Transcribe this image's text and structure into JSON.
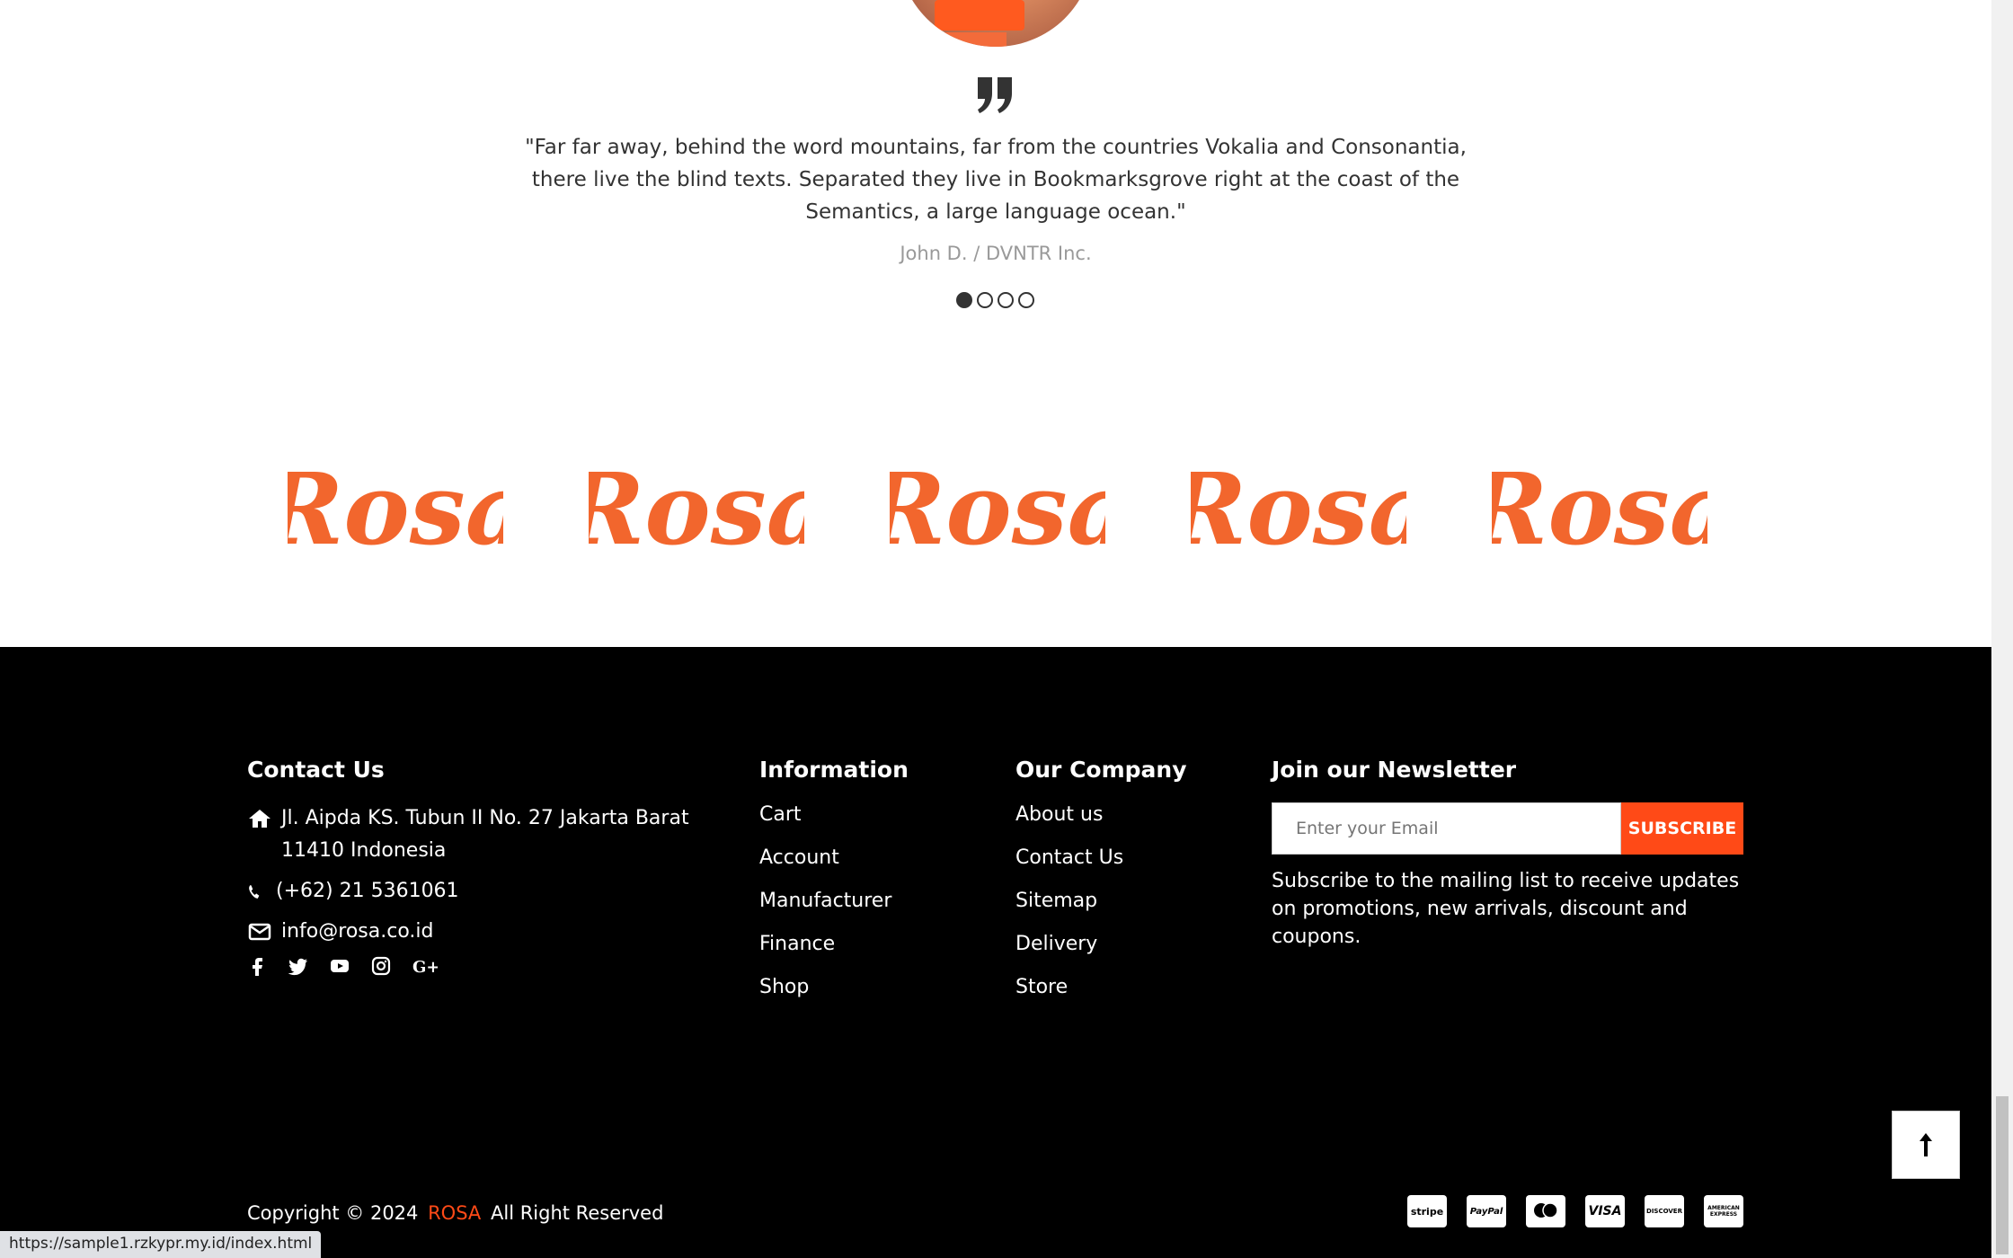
{
  "testimonial": {
    "quote": "\"Far far away, behind the word mountains, far from the countries Vokalia and Consonantia, there live the blind texts. Separated they live in Bookmarksgrove right at the coast of the Semantics, a large language ocean.\"",
    "author": "John D. / DVNTR Inc.",
    "active_dot": 1,
    "dot_count": 4
  },
  "logos": [
    "Rosa",
    "Rosa",
    "Rosa",
    "Rosa",
    "Rosa"
  ],
  "footer": {
    "contact": {
      "title": "Contact Us",
      "address": "Jl. Aipda KS. Tubun II No. 27 Jakarta Barat 11410 Indonesia",
      "phone": "(+62) 21 5361061",
      "email": "info@rosa.co.id",
      "social_icons": [
        "facebook-icon",
        "twitter-icon",
        "youtube-icon",
        "instagram-icon",
        "google-plus-icon"
      ]
    },
    "information": {
      "title": "Information",
      "links": [
        "Cart",
        "Account",
        "Manufacturer",
        "Finance",
        "Shop"
      ]
    },
    "company": {
      "title": "Our Company",
      "links": [
        "About us",
        "Contact Us",
        "Sitemap",
        "Delivery",
        "Store"
      ]
    },
    "newsletter": {
      "title": "Join our Newsletter",
      "placeholder": "Enter your Email",
      "button": "SUBSCRIBE",
      "description": "Subscribe to the mailing list to receive updates on promotions, new arrivals, discount and coupons."
    },
    "copyright": {
      "prefix": "Copyright © 2024",
      "brand": "ROSA",
      "suffix": "All Right Reserved"
    },
    "payments": [
      "stripe",
      "PayPal",
      "mastercard",
      "VISA",
      "DISCOVER",
      "AMERICAN EXPRESS"
    ]
  },
  "colors": {
    "accent": "#ff4a17",
    "logo": "#f2662d",
    "footer_bg": "#000000"
  },
  "status_bar": {
    "url": "https://sample1.rzkypr.my.id/index.html"
  }
}
